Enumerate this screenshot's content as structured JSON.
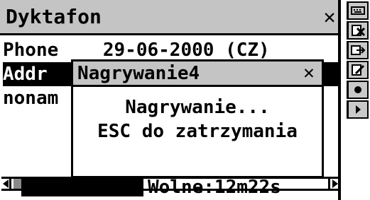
{
  "window": {
    "title": "Dyktafon",
    "close_glyph": "✕"
  },
  "list": {
    "rows": [
      {
        "text": "Phone    29-06-2000 (CZ)",
        "selected": false
      },
      {
        "text": "Addr",
        "selected": true
      },
      {
        "text": "nonam",
        "selected": false
      }
    ]
  },
  "status": {
    "level_fraction": 1.0,
    "free_label": "Wolne:12m22s"
  },
  "dialog": {
    "title": "Nagrywanie4",
    "close_glyph": "✕",
    "line1": "Nagrywanie...",
    "line2": "ESC do zatrzymania"
  },
  "toolbar": {
    "icons": [
      "keyboard-icon",
      "delete-file-icon",
      "export-icon",
      "edit-icon",
      "record-icon",
      "play-icon"
    ]
  },
  "colors": {
    "titlebar_gray": "#c4c4c4",
    "scroll_thumb": "#8a8a8a",
    "toolbar_gray": "#c9c9c9"
  }
}
